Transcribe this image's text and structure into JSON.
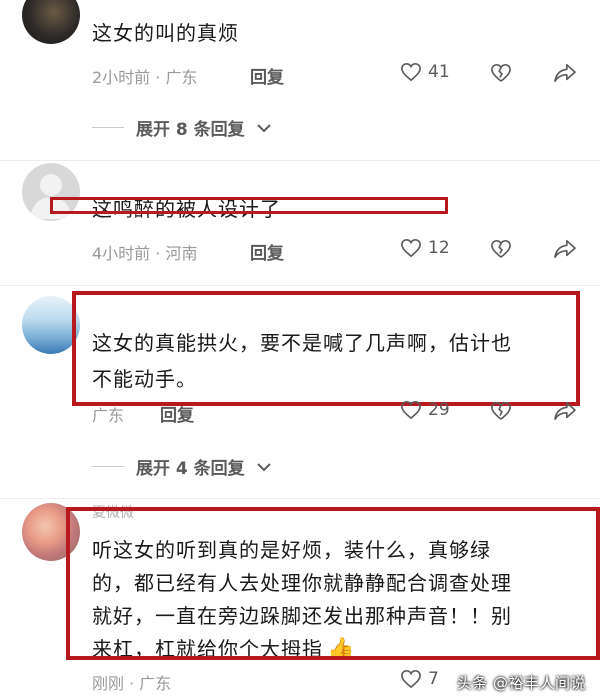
{
  "comments": [
    {
      "text": "这女的叫的真烦",
      "time_location": "2小时前 · 广东",
      "reply_label": "回复",
      "likes": "41"
    },
    {
      "text": "这鸣醉的被人设计了",
      "time_location": "4小时前 · 河南",
      "reply_label": "回复",
      "likes": "12"
    },
    {
      "text_line1": "这女的真能拱火，要不是喊了几声啊，估计也",
      "text_line2": "不能动手。",
      "time_location": "广东",
      "reply_label": "回复",
      "likes": "29"
    },
    {
      "username": "夏微微",
      "text_line1": "听这女的听到真的是好烦，装什么，真够绿",
      "text_line2": "的，都已经有人去处理你就静静配合调查处理",
      "text_line3": "就好，一直在旁边跺脚还发出那种声音！！别",
      "text_line4": "来杠，杠就给你个大拇指",
      "time_location": "刚刚 · 广东",
      "likes": "7"
    }
  ],
  "expand_replies": [
    {
      "label": "展开 8 条回复"
    },
    {
      "label": "展开 4 条回复"
    }
  ],
  "watermark": "头条 @裕丰人间说",
  "colors": {
    "highlight_box": "#b8191e",
    "meta_text": "#9a9a9a",
    "action_text": "#5a5a5a"
  },
  "icons": [
    "heart-icon",
    "broken-heart-icon",
    "share-arrow-icon",
    "chevron-down-icon",
    "thumbs-up-emoji"
  ]
}
